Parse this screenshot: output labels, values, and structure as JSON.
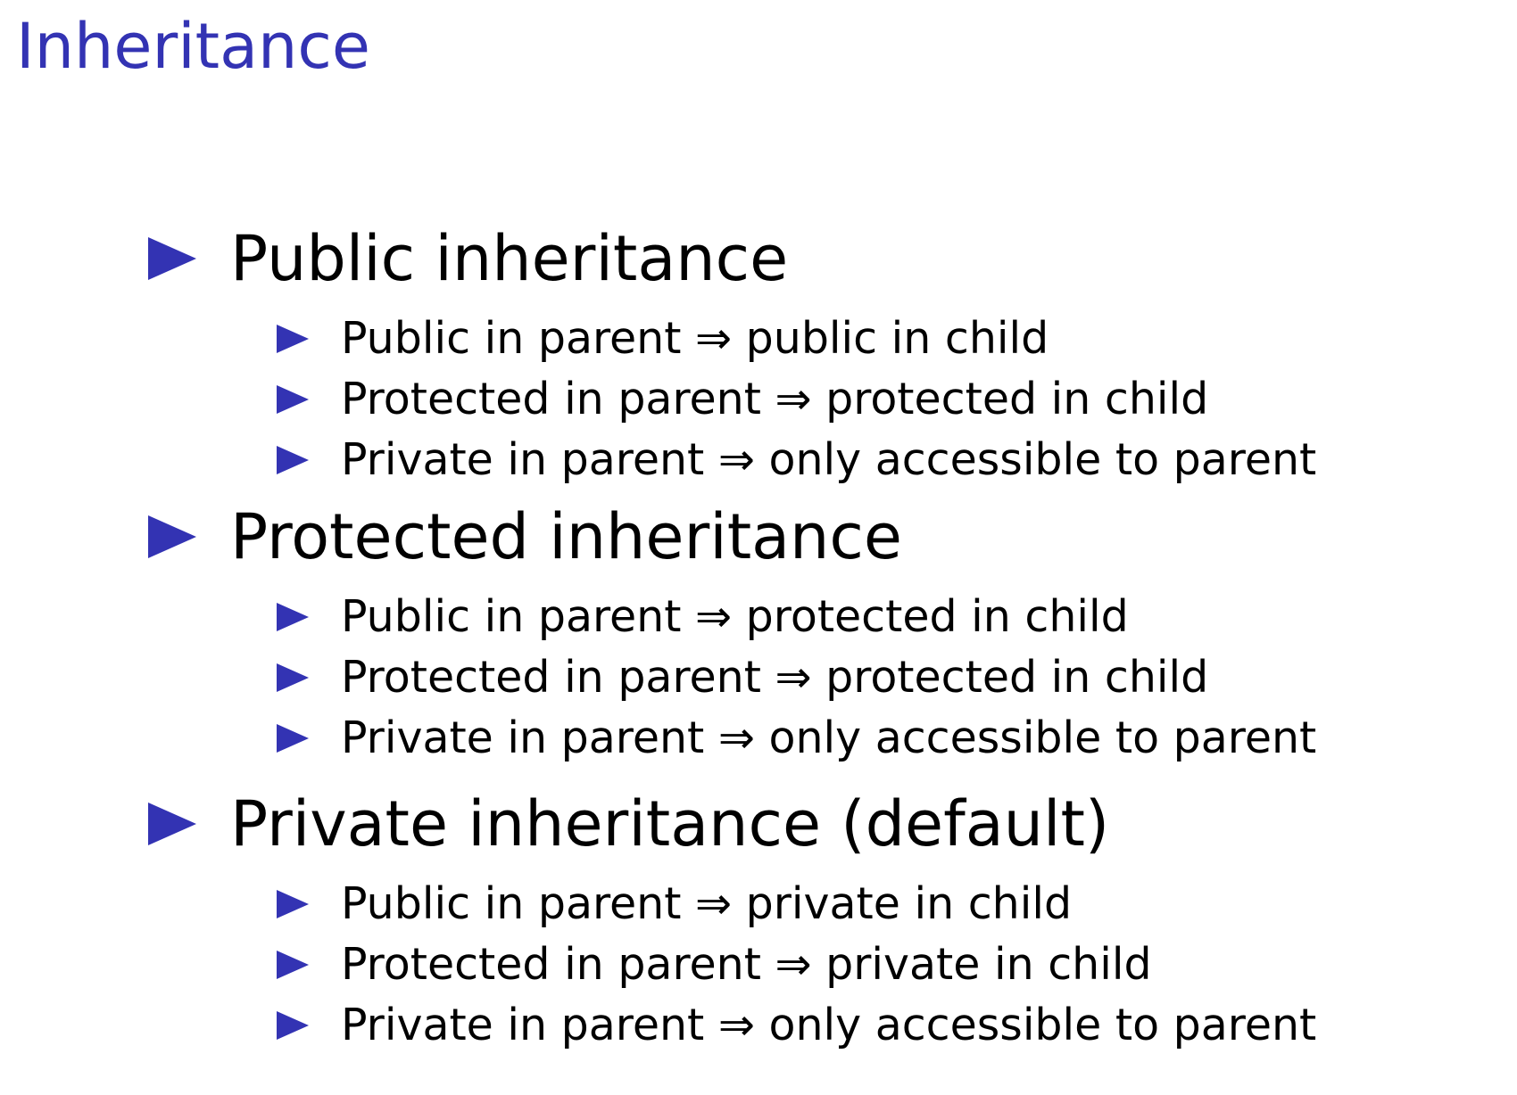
{
  "title": "Inheritance",
  "colors": {
    "accent": "#3333b3",
    "text": "#000000",
    "background": "#ffffff"
  },
  "bullet_icon": "triangle-right-icon",
  "sections": [
    {
      "heading": "Public inheritance",
      "items": [
        {
          "parent": "Public in parent",
          "arrow": "⇒",
          "child": "public in child"
        },
        {
          "parent": "Protected in parent",
          "arrow": "⇒",
          "child": "protected in child"
        },
        {
          "parent": "Private in parent",
          "arrow": "⇒",
          "child": "only accessible to parent"
        }
      ]
    },
    {
      "heading": "Protected inheritance",
      "items": [
        {
          "parent": "Public in parent",
          "arrow": "⇒",
          "child": "protected in child"
        },
        {
          "parent": "Protected in parent",
          "arrow": "⇒",
          "child": "protected in child"
        },
        {
          "parent": "Private in parent",
          "arrow": "⇒",
          "child": "only accessible to parent"
        }
      ]
    },
    {
      "heading": "Private inheritance (default)",
      "items": [
        {
          "parent": "Public in parent",
          "arrow": "⇒",
          "child": "private in child"
        },
        {
          "parent": "Protected in parent",
          "arrow": "⇒",
          "child": "private in child"
        },
        {
          "parent": "Private in parent",
          "arrow": "⇒",
          "child": "only accessible to parent"
        }
      ]
    }
  ]
}
